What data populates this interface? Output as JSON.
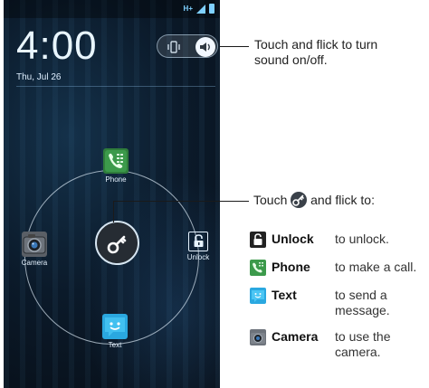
{
  "phone": {
    "status": {
      "network": "H+"
    },
    "clock": "4:00",
    "date": "Thu, Jul 26",
    "targets": {
      "phone": "Phone",
      "camera": "Camera",
      "unlock": "Unlock",
      "text": "Text"
    }
  },
  "annotations": {
    "sound_note": "Touch and flick to turn sound on/off.",
    "touch_prefix": "Touch",
    "touch_suffix": "and flick to:",
    "legend": [
      {
        "name": "Unlock",
        "desc": "to unlock.",
        "icon": "lock-icon"
      },
      {
        "name": "Phone",
        "desc": "to make a call.",
        "icon": "phone-app-icon"
      },
      {
        "name": "Text",
        "desc": "to send a message.",
        "icon": "text-app-icon"
      },
      {
        "name": "Camera",
        "desc": "to use the camera.",
        "icon": "camera-app-icon"
      }
    ]
  },
  "colors": {
    "accent": "#33b5e5",
    "phone_green": "#4caf50",
    "text_blue": "#2aa8e0"
  }
}
